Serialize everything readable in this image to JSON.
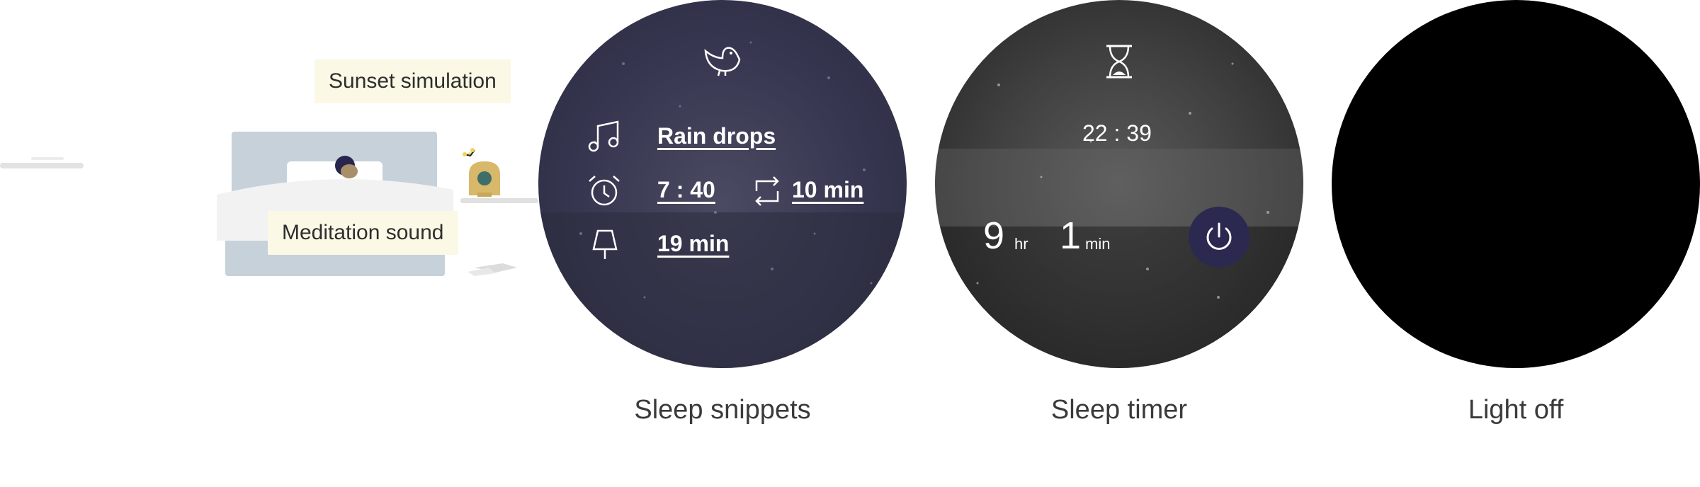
{
  "illustration": {
    "sunset_label": "Sunset simulation",
    "meditation_label": "Meditation sound"
  },
  "snippets_screen": {
    "sound": "Rain drops",
    "alarm_time": "7 : 40",
    "snooze": "10 min",
    "light_duration": "19 min",
    "icons": [
      "bird-icon",
      "music-note-icon",
      "alarm-clock-icon",
      "repeat-icon",
      "lamp-icon"
    ],
    "caption": "Sleep snippets"
  },
  "timer_screen": {
    "clock": "22 : 39",
    "hours": "9",
    "hours_unit": "hr",
    "minutes": "1",
    "minutes_unit": "min",
    "icons": [
      "hourglass-icon",
      "power-icon"
    ],
    "caption": "Sleep timer"
  },
  "off_screen": {
    "caption": "Light off"
  },
  "colors": {
    "snippets_bg": "#3b3b52",
    "timer_bg": "#3a3a3a",
    "power_button": "#2b2950",
    "tag_bg": "#fbf8e6",
    "lamp": "#d8b869"
  }
}
